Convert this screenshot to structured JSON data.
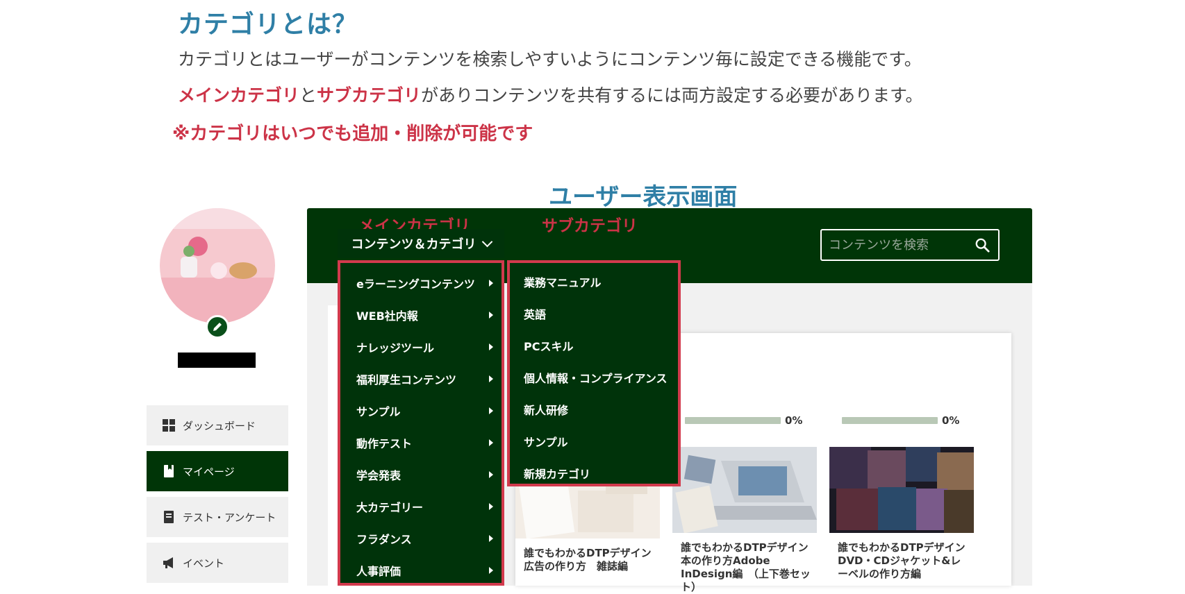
{
  "intro": {
    "heading": "カテゴリとは？",
    "line1": "カテゴリとはユーザーがコンテンツを検索しやすいようにコンテンツ毎に設定できる機能です。",
    "line2_main": "メインカテゴリ",
    "line2_and": "と",
    "line2_sub": "サブカテゴリ",
    "line2_rest": "がありコンテンツを共有するには両方設定する必要があります。",
    "note": "※カテゴリはいつでも追加・削除が可能です"
  },
  "screen_title": "ユーザー表示画面",
  "labels": {
    "main_category": "メインカテゴリ",
    "sub_category": "サブカテゴリ"
  },
  "nav": {
    "trigger_label": "コンテンツ＆カテゴリ"
  },
  "search": {
    "placeholder": "コンテンツを検索"
  },
  "main_menu": {
    "items": [
      {
        "label": "eラーニングコンテンツ"
      },
      {
        "label": "WEB社内報"
      },
      {
        "label": "ナレッジツール"
      },
      {
        "label": "福利厚生コンテンツ"
      },
      {
        "label": "サンプル"
      },
      {
        "label": "動作テスト"
      },
      {
        "label": "学会発表"
      },
      {
        "label": "大カテゴリー"
      },
      {
        "label": "フラダンス"
      },
      {
        "label": "人事評価"
      }
    ]
  },
  "sub_menu": {
    "items": [
      {
        "label": "業務マニュアル"
      },
      {
        "label": "英語"
      },
      {
        "label": "PCスキル"
      },
      {
        "label": "個人情報・コンプライアンス"
      },
      {
        "label": "新人研修"
      },
      {
        "label": "サンプル"
      },
      {
        "label": "新規カテゴリ"
      }
    ]
  },
  "sidebar": {
    "items": [
      {
        "label": "ダッシュボード",
        "icon": "dashboard-icon"
      },
      {
        "label": "マイページ",
        "icon": "bookmark-icon",
        "active": true
      },
      {
        "label": "テスト・アンケート",
        "icon": "notebook-icon"
      },
      {
        "label": "イベント",
        "icon": "megaphone-icon"
      }
    ]
  },
  "cards": [
    {
      "progress": "",
      "title": "誰でもわかるDTPデザイン　広告の作り方　雑誌編"
    },
    {
      "progress": "0%",
      "title": "誰でもわかるDTPデザイン　本の作り方Adobe InDesign編　（上下巻セット）"
    },
    {
      "progress": "0%",
      "title": "誰でもわかるDTPデザイン　DVD・CDジャケット&レーベルの作り方編"
    }
  ],
  "colors": {
    "brand_green": "#003507",
    "accent_red": "#cc3347",
    "heading_blue": "#2f7fa6"
  }
}
